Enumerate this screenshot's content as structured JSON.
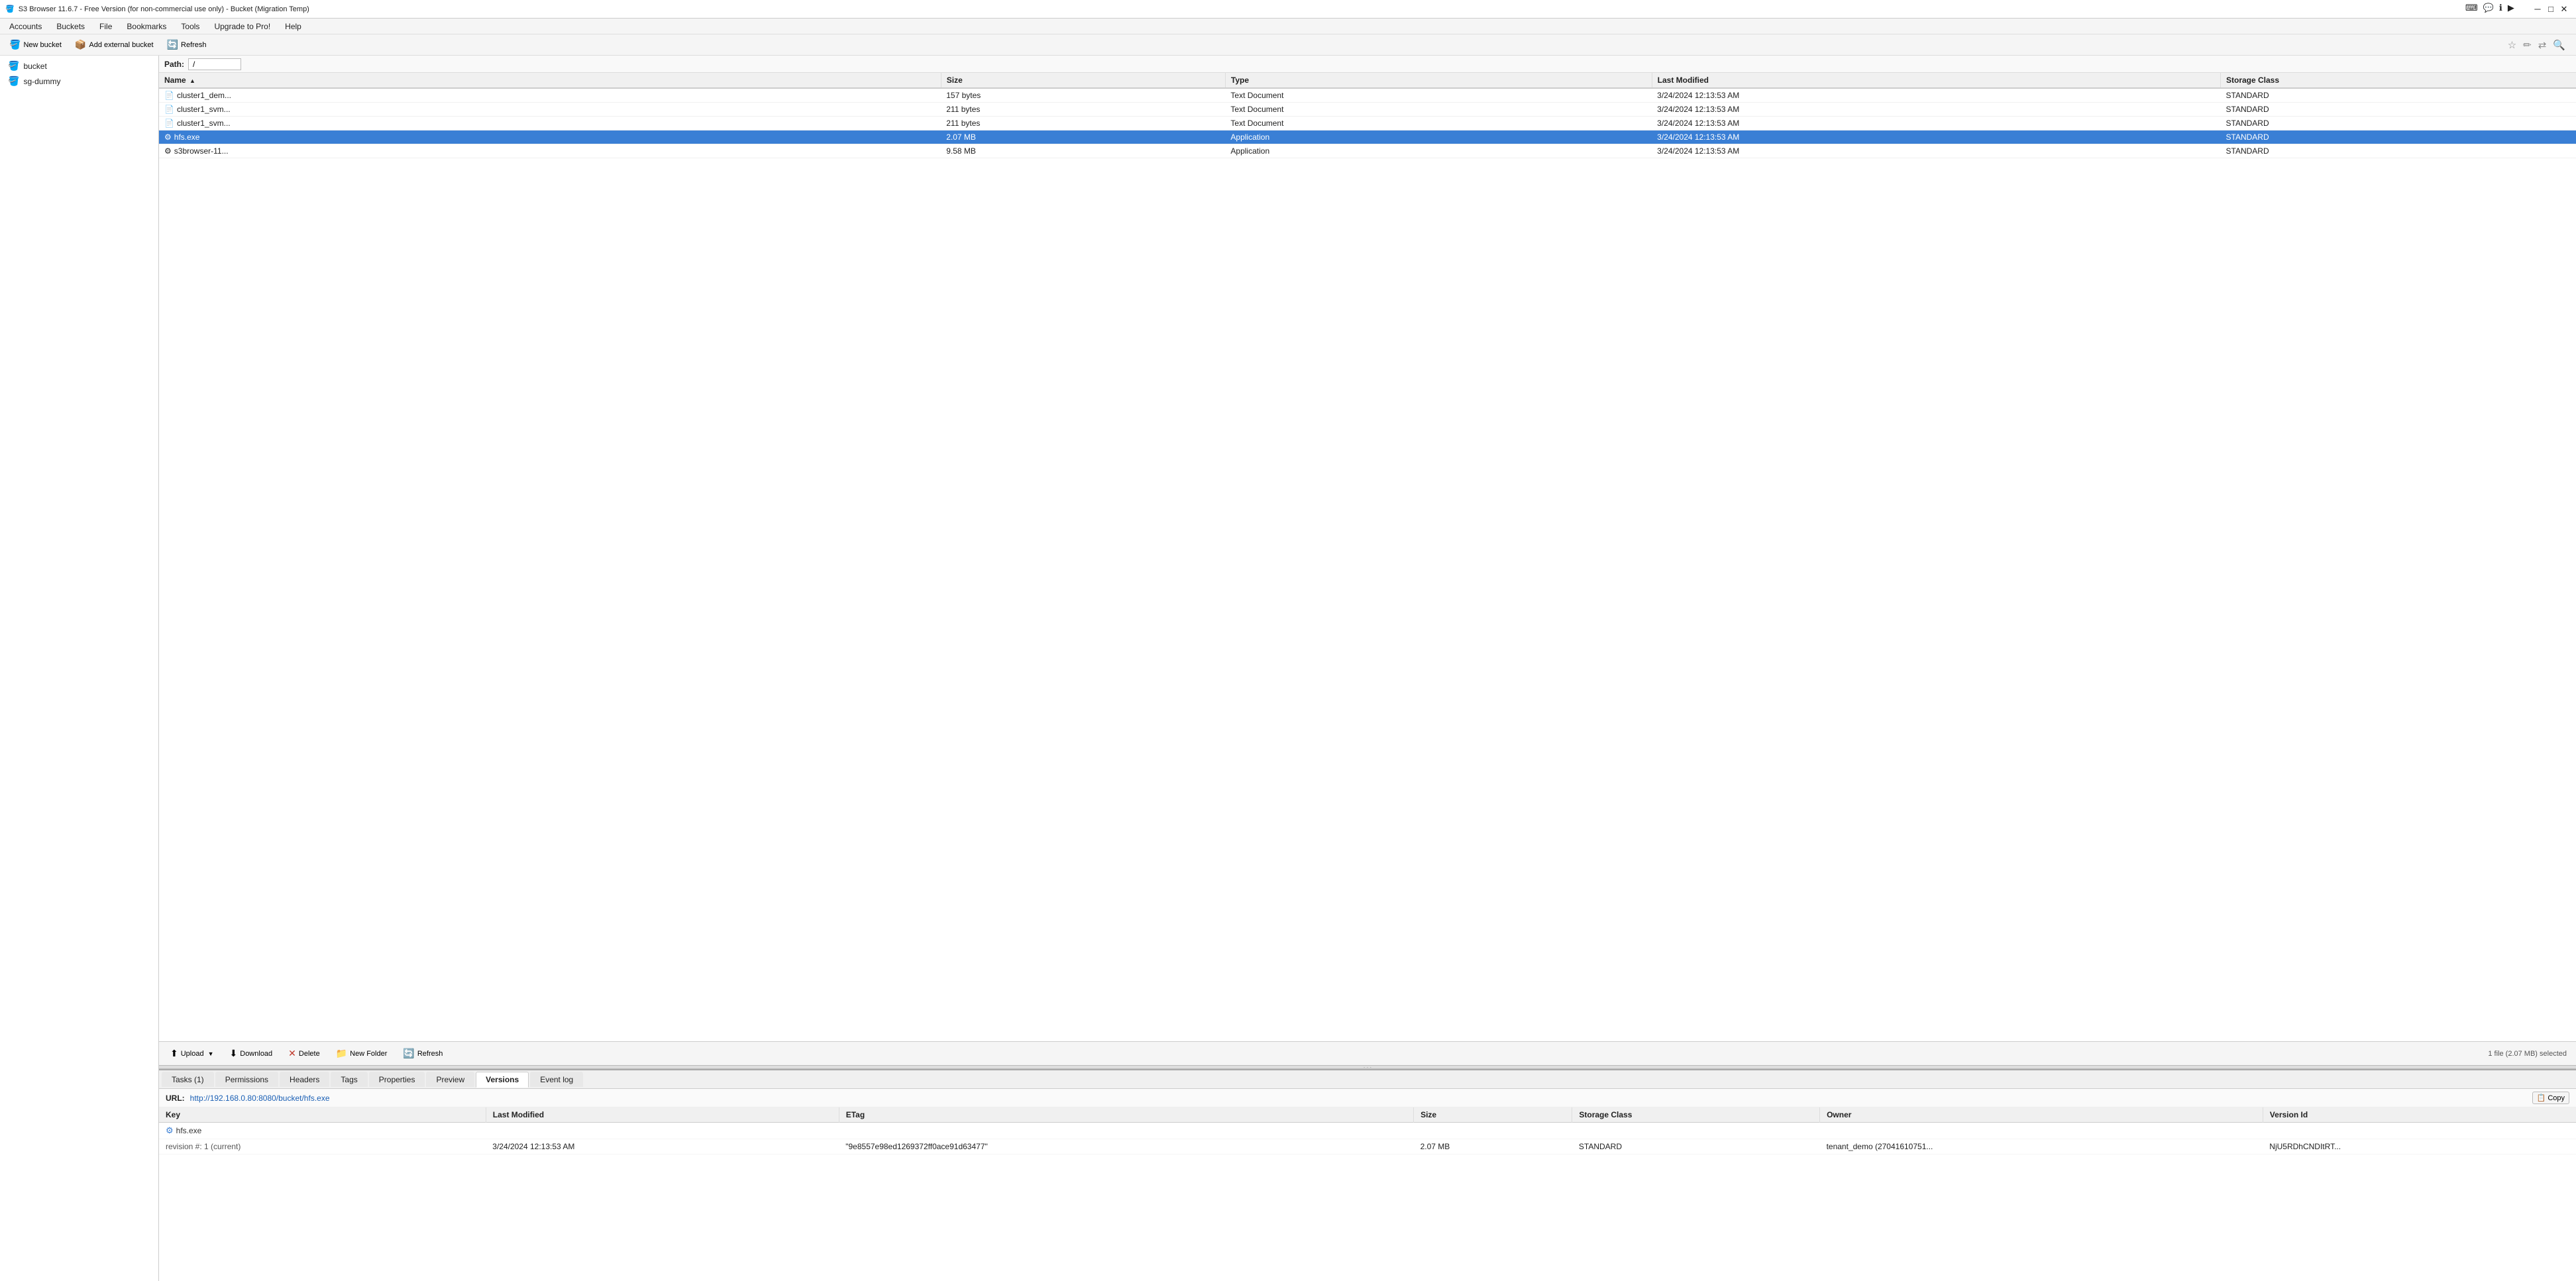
{
  "window": {
    "title": "S3 Browser 11.6.7 - Free Version (for non-commercial use only) - Bucket (Migration Temp)"
  },
  "titlebar": {
    "icons": [
      "⌨",
      "💬",
      "ℹ",
      "▶"
    ],
    "min": "─",
    "max": "□",
    "close": "✕"
  },
  "menu": {
    "items": [
      "Accounts",
      "Buckets",
      "File",
      "Bookmarks",
      "Tools",
      "Upgrade to Pro!",
      "Help"
    ]
  },
  "toolbar": {
    "new_bucket": "New bucket",
    "add_external": "Add external bucket",
    "refresh": "Refresh"
  },
  "path": {
    "label": "Path:",
    "value": "/"
  },
  "sidebar": {
    "items": [
      {
        "name": "bucket",
        "icon": "📁",
        "type": "bucket"
      },
      {
        "name": "sg-dummy",
        "icon": "📁",
        "type": "bucket"
      }
    ]
  },
  "file_list": {
    "columns": [
      "Name",
      "Size",
      "Type",
      "Last Modified",
      "Storage Class"
    ],
    "rows": [
      {
        "name": "cluster1_dem...",
        "size": "157 bytes",
        "type": "Text Document",
        "modified": "3/24/2024 12:13:53 AM",
        "storage": "STANDARD",
        "selected": false,
        "icon": "📄"
      },
      {
        "name": "cluster1_svm...",
        "size": "211 bytes",
        "type": "Text Document",
        "modified": "3/24/2024 12:13:53 AM",
        "storage": "STANDARD",
        "selected": false,
        "icon": "📄"
      },
      {
        "name": "cluster1_svm...",
        "size": "211 bytes",
        "type": "Text Document",
        "modified": "3/24/2024 12:13:53 AM",
        "storage": "STANDARD",
        "selected": false,
        "icon": "📄"
      },
      {
        "name": "hfs.exe",
        "size": "2.07 MB",
        "type": "Application",
        "modified": "3/24/2024 12:13:53 AM",
        "storage": "STANDARD",
        "selected": true,
        "icon": "⚙"
      },
      {
        "name": "s3browser-11...",
        "size": "9.58 MB",
        "type": "Application",
        "modified": "3/24/2024 12:13:53 AM",
        "storage": "STANDARD",
        "selected": false,
        "icon": "⚙"
      }
    ]
  },
  "file_toolbar": {
    "upload": "Upload",
    "download": "Download",
    "delete": "Delete",
    "new_folder": "New Folder",
    "refresh": "Refresh"
  },
  "status": {
    "text": "1 file (2.07 MB) selected"
  },
  "tabs": {
    "items": [
      "Tasks (1)",
      "Permissions",
      "Headers",
      "Tags",
      "Properties",
      "Preview",
      "Versions",
      "Event log"
    ],
    "active": "Versions"
  },
  "url_bar": {
    "label": "URL:",
    "value": "http://192.168.0.80:8080/bucket/hfs.exe",
    "copy_label": "📋 Copy"
  },
  "versions_table": {
    "columns": [
      "Key",
      "Last Modified",
      "ETag",
      "Size",
      "Storage Class",
      "Owner",
      "Version Id"
    ],
    "rows": [
      {
        "key": "hfs.exe",
        "key_icon": "⚙",
        "modified": "",
        "etag": "",
        "size": "",
        "storage": "",
        "owner": "",
        "version_id": ""
      },
      {
        "key": "revision #: 1 (current)",
        "key_icon": "",
        "modified": "3/24/2024 12:13:53 AM",
        "etag": "\"9e8557e98ed1269372ff0ace91d63477\"",
        "size": "2.07 MB",
        "storage": "STANDARD",
        "owner": "tenant_demo (27041610751...",
        "version_id": "NjU5RDhCNDItRT..."
      }
    ]
  }
}
